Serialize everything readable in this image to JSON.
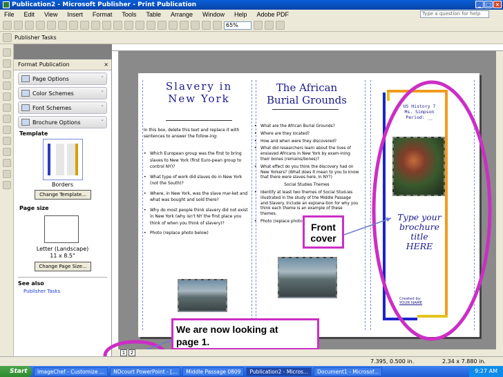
{
  "window": {
    "title": "Publication2 - Microsoft Publisher - Print Publication"
  },
  "menu": [
    "File",
    "Edit",
    "View",
    "Insert",
    "Format",
    "Tools",
    "Table",
    "Arrange",
    "Window",
    "Help",
    "Adobe PDF"
  ],
  "help_placeholder": "Type a question for help",
  "toolbar": {
    "zoom": "65%"
  },
  "toolbar2": {
    "publisher_tasks": "Publisher Tasks"
  },
  "taskpane": {
    "title": "Format Publication",
    "buttons": [
      "Page Options",
      "Color Schemes",
      "Font Schemes",
      "Brochure Options"
    ],
    "template_label": "Template",
    "template_name": "Borders",
    "change_template": "Change Template...",
    "page_size_label": "Page size",
    "page_size_value": "Letter (Landscape)",
    "page_size_dims": "11 x 8.5\"",
    "change_page_size": "Change Page Size...",
    "see_also": "See also",
    "link": "Publisher Tasks"
  },
  "panel1": {
    "title_line1": "Slavery in",
    "title_line2": "New York",
    "intro": "In this box, delete this text and replace it with sentences to answer the follow-ing:",
    "items": [
      "Which European group was the first to bring slaves to New York (first Euro-pean group to control NY)?",
      "What type of work did slaves do in New York (not the South)?",
      "Where, in New York, was the slave mar-ket and what was bought and sold there?",
      "Why do most people think slavery did not exist in New York (why isn't NY the first place you think of when you think of slavery)?",
      "Photo (replace photo below)"
    ]
  },
  "panel2": {
    "title_line1": "The African",
    "title_line2": "Burial Grounds",
    "items": [
      "What are the African Burial Grounds?",
      "Where are they located?",
      "How and when were they discovered?",
      "What did researchers learn about the lives of enslaved Africans in New York by exam-ining their bones (remains/bones)?",
      "What effect do you think the discovery had on New Yorkers? (What does it mean to you to know that there were slaves here, in NY?)"
    ],
    "social_studies": "Social Studies Themes",
    "items2": [
      "Identify at least two themes of Social Stud-ies illustrated in the study of the Middle Passage and Slavery. Include an explana-tion for why you think each theme is an example of these themes.",
      "Photo (replace photo below)"
    ]
  },
  "front": {
    "course": "US History 7",
    "teacher": "Ms. Simpson",
    "period": "Period: __",
    "type_line1": "Type your",
    "type_line2": "brochure",
    "type_line3": "title",
    "type_line4": "HERE",
    "created_by": "Created by:",
    "your_name": "YOUR NAME"
  },
  "callouts": {
    "front_line1": "Front",
    "front_line2": "cover",
    "page_line1": "We are now looking at",
    "page_line2": "page 1."
  },
  "page_tabs": [
    "1",
    "2"
  ],
  "status": {
    "position": "7.395, 0.500 in.",
    "size": "2.34 x 7.880 in."
  },
  "taskbar": {
    "start": "Start",
    "items": [
      "ImageChef - Customize ...",
      "NDcourt PowerPoint - [...",
      "Middle Passage 0809",
      "Publication2 - Micros...",
      "Document1 - Microsof..."
    ],
    "clock": "9:27 AM"
  },
  "colors": {
    "accent_blue": "#1c24c8",
    "accent_orange": "#f19a1e",
    "accent_yellow": "#e3c31e",
    "annotation_magenta": "#cc2ec4"
  }
}
